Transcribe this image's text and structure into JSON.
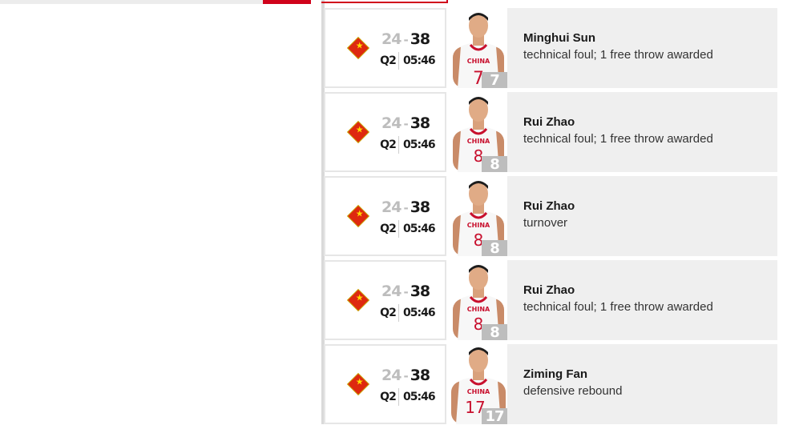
{
  "colors": {
    "accent": "#d0021b",
    "flag_red": "#de2910",
    "flag_yellow": "#ffde00",
    "panel_bg": "#efefef"
  },
  "team_icon": "china-flag-icon",
  "events": [
    {
      "home": "24",
      "away": "38",
      "period": "Q2",
      "clock": "05:46",
      "player": "Minghui Sun",
      "action": "technical foul; 1 free throw awarded",
      "jersey_text": "CHINA",
      "jersey_num": "7",
      "badge": "7"
    },
    {
      "home": "24",
      "away": "38",
      "period": "Q2",
      "clock": "05:46",
      "player": "Rui Zhao",
      "action": "technical foul; 1 free throw awarded",
      "jersey_text": "CHINA",
      "jersey_num": "8",
      "badge": "8"
    },
    {
      "home": "24",
      "away": "38",
      "period": "Q2",
      "clock": "05:46",
      "player": "Rui Zhao",
      "action": "turnover",
      "jersey_text": "CHINA",
      "jersey_num": "8",
      "badge": "8"
    },
    {
      "home": "24",
      "away": "38",
      "period": "Q2",
      "clock": "05:46",
      "player": "Rui Zhao",
      "action": "technical foul; 1 free throw awarded",
      "jersey_text": "CHINA",
      "jersey_num": "8",
      "badge": "8"
    },
    {
      "home": "24",
      "away": "38",
      "period": "Q2",
      "clock": "05:46",
      "player": "Ziming Fan",
      "action": "defensive rebound",
      "jersey_text": "CHINA",
      "jersey_num": "17",
      "badge": "17"
    }
  ],
  "dash": "-"
}
